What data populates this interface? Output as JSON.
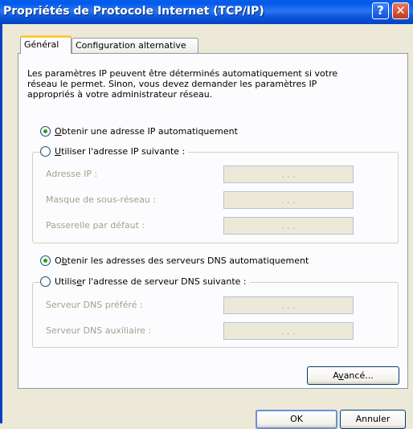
{
  "window": {
    "title": "Propriétés de Protocole Internet (TCP/IP)",
    "help_glyph": "?",
    "close_glyph": "✕"
  },
  "tabs": [
    {
      "label": "Général",
      "active": true
    },
    {
      "label": "Configuration alternative",
      "active": false
    }
  ],
  "intro_text": "Les paramètres IP peuvent être déterminés automatiquement si votre\nréseau le permet. Sinon, vous devez demander les paramètres IP\nappropriés à votre administrateur réseau.",
  "ip_section": {
    "auto_option": {
      "prefix": "",
      "accel": "O",
      "rest": "btenir une adresse IP automatiquement",
      "checked": true
    },
    "manual_option": {
      "prefix": "",
      "accel": "U",
      "rest": "tiliser l'adresse IP suivante :",
      "checked": false
    },
    "fields": [
      {
        "label": "Adresse IP :",
        "value": ".     .     ."
      },
      {
        "label": "Masque de sous-réseau :",
        "value": ".     .     ."
      },
      {
        "label": "Passerelle par défaut :",
        "value": ".     .     ."
      }
    ]
  },
  "dns_section": {
    "auto_option": {
      "prefix": "O",
      "accel": "b",
      "rest": "tenir les adresses des serveurs DNS automatiquement",
      "checked": true
    },
    "manual_option": {
      "prefix": "Utilis",
      "accel": "e",
      "rest": "r l'adresse de serveur DNS suivante :",
      "checked": false
    },
    "fields": [
      {
        "label": "Serveur DNS préféré :",
        "value": ".     .     ."
      },
      {
        "label": "Serveur DNS auxiliaire :",
        "value": ".     .     ."
      }
    ]
  },
  "buttons": {
    "advanced": {
      "prefix": "A",
      "accel": "v",
      "rest": "ancé..."
    },
    "ok": "OK",
    "cancel": "Annuler"
  }
}
